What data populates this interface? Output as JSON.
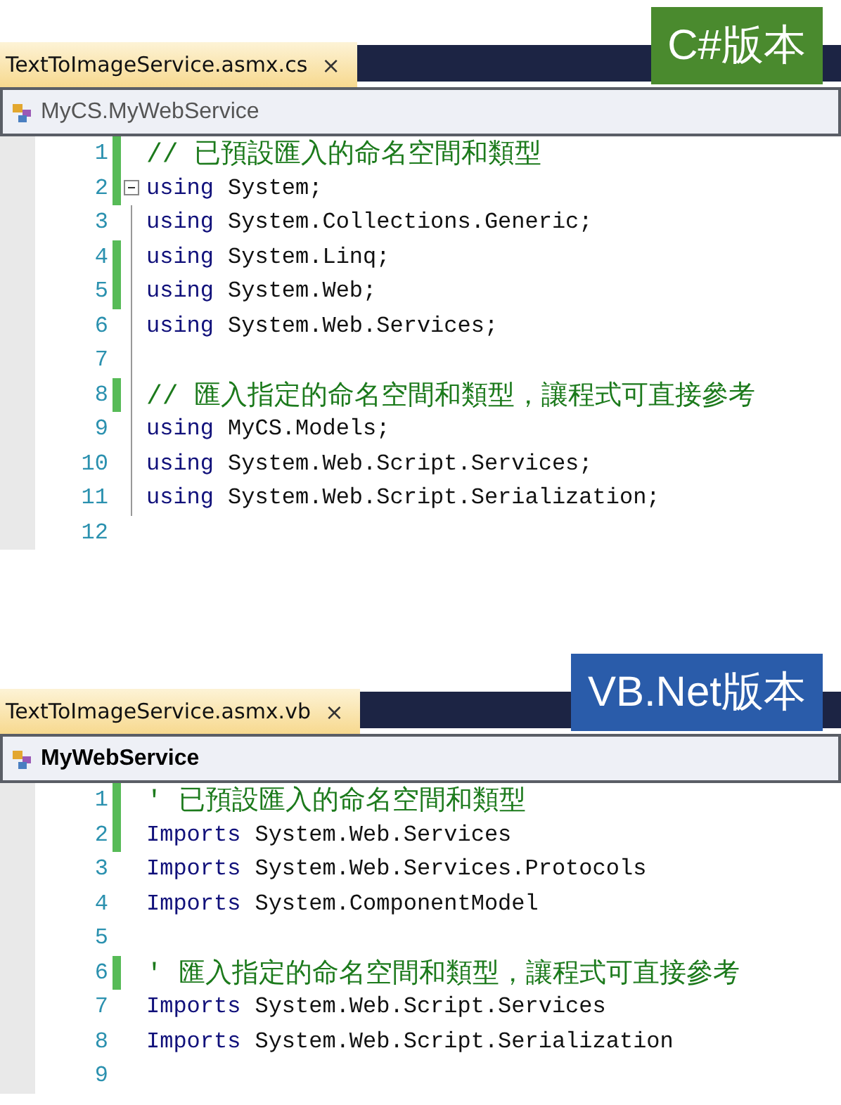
{
  "panels": [
    {
      "tab": {
        "label": "TextToImageService.asmx.cs",
        "close": "×"
      },
      "badge": {
        "label": "C#版本",
        "color": "#4a8a2e"
      },
      "navigator": {
        "label": "MyCS.MyWebService"
      },
      "lines": [
        {
          "number": "1",
          "kind": "comment",
          "text": "// 已預設匯入的命名空間和類型",
          "changed": true,
          "fold_start": false,
          "in_region": false
        },
        {
          "number": "2",
          "kind": "code",
          "keyword": "using",
          "text": "System;",
          "changed": true,
          "fold_start": true,
          "in_region": false
        },
        {
          "number": "3",
          "kind": "code",
          "keyword": "using",
          "text": "System.Collections.Generic;",
          "changed": false,
          "fold_start": false,
          "in_region": true
        },
        {
          "number": "4",
          "kind": "code",
          "keyword": "using",
          "text": "System.Linq;",
          "changed": true,
          "fold_start": false,
          "in_region": true
        },
        {
          "number": "5",
          "kind": "code",
          "keyword": "using",
          "text": "System.Web;",
          "changed": true,
          "fold_start": false,
          "in_region": true
        },
        {
          "number": "6",
          "kind": "code",
          "keyword": "using",
          "text": "System.Web.Services;",
          "changed": false,
          "fold_start": false,
          "in_region": true
        },
        {
          "number": "7",
          "kind": "blank",
          "changed": false,
          "fold_start": false,
          "in_region": true
        },
        {
          "number": "8",
          "kind": "comment",
          "text": "// 匯入指定的命名空間和類型，讓程式可直接參考",
          "changed": true,
          "fold_start": false,
          "in_region": true
        },
        {
          "number": "9",
          "kind": "code",
          "keyword": "using",
          "text": "MyCS.Models;",
          "changed": false,
          "fold_start": false,
          "in_region": true
        },
        {
          "number": "10",
          "kind": "code",
          "keyword": "using",
          "text": "System.Web.Script.Services;",
          "changed": false,
          "fold_start": false,
          "in_region": true
        },
        {
          "number": "11",
          "kind": "code",
          "keyword": "using",
          "text": "System.Web.Script.Serialization;",
          "changed": false,
          "fold_start": false,
          "in_region": true
        },
        {
          "number": "12",
          "kind": "blank",
          "changed": false,
          "fold_start": false,
          "in_region": false
        }
      ]
    },
    {
      "tab": {
        "label": "TextToImageService.asmx.vb",
        "close": "×"
      },
      "badge": {
        "label": "VB.Net版本",
        "color": "#2a5caa"
      },
      "navigator": {
        "label": "MyWebService"
      },
      "lines": [
        {
          "number": "1",
          "kind": "comment",
          "text": "' 已預設匯入的命名空間和類型",
          "changed": true
        },
        {
          "number": "2",
          "kind": "code",
          "keyword": "Imports",
          "text": "System.Web.Services",
          "changed": true
        },
        {
          "number": "3",
          "kind": "code",
          "keyword": "Imports",
          "text": "System.Web.Services.Protocols",
          "changed": false
        },
        {
          "number": "4",
          "kind": "code",
          "keyword": "Imports",
          "text": "System.ComponentModel",
          "changed": false
        },
        {
          "number": "5",
          "kind": "blank",
          "changed": false
        },
        {
          "number": "6",
          "kind": "comment",
          "text": "' 匯入指定的命名空間和類型，讓程式可直接參考",
          "changed": true
        },
        {
          "number": "7",
          "kind": "code",
          "keyword": "Imports",
          "text": "System.Web.Script.Services",
          "changed": false
        },
        {
          "number": "8",
          "kind": "code",
          "keyword": "Imports",
          "text": "System.Web.Script.Serialization",
          "changed": false
        },
        {
          "number": "9",
          "kind": "blank",
          "changed": false
        }
      ]
    }
  ]
}
